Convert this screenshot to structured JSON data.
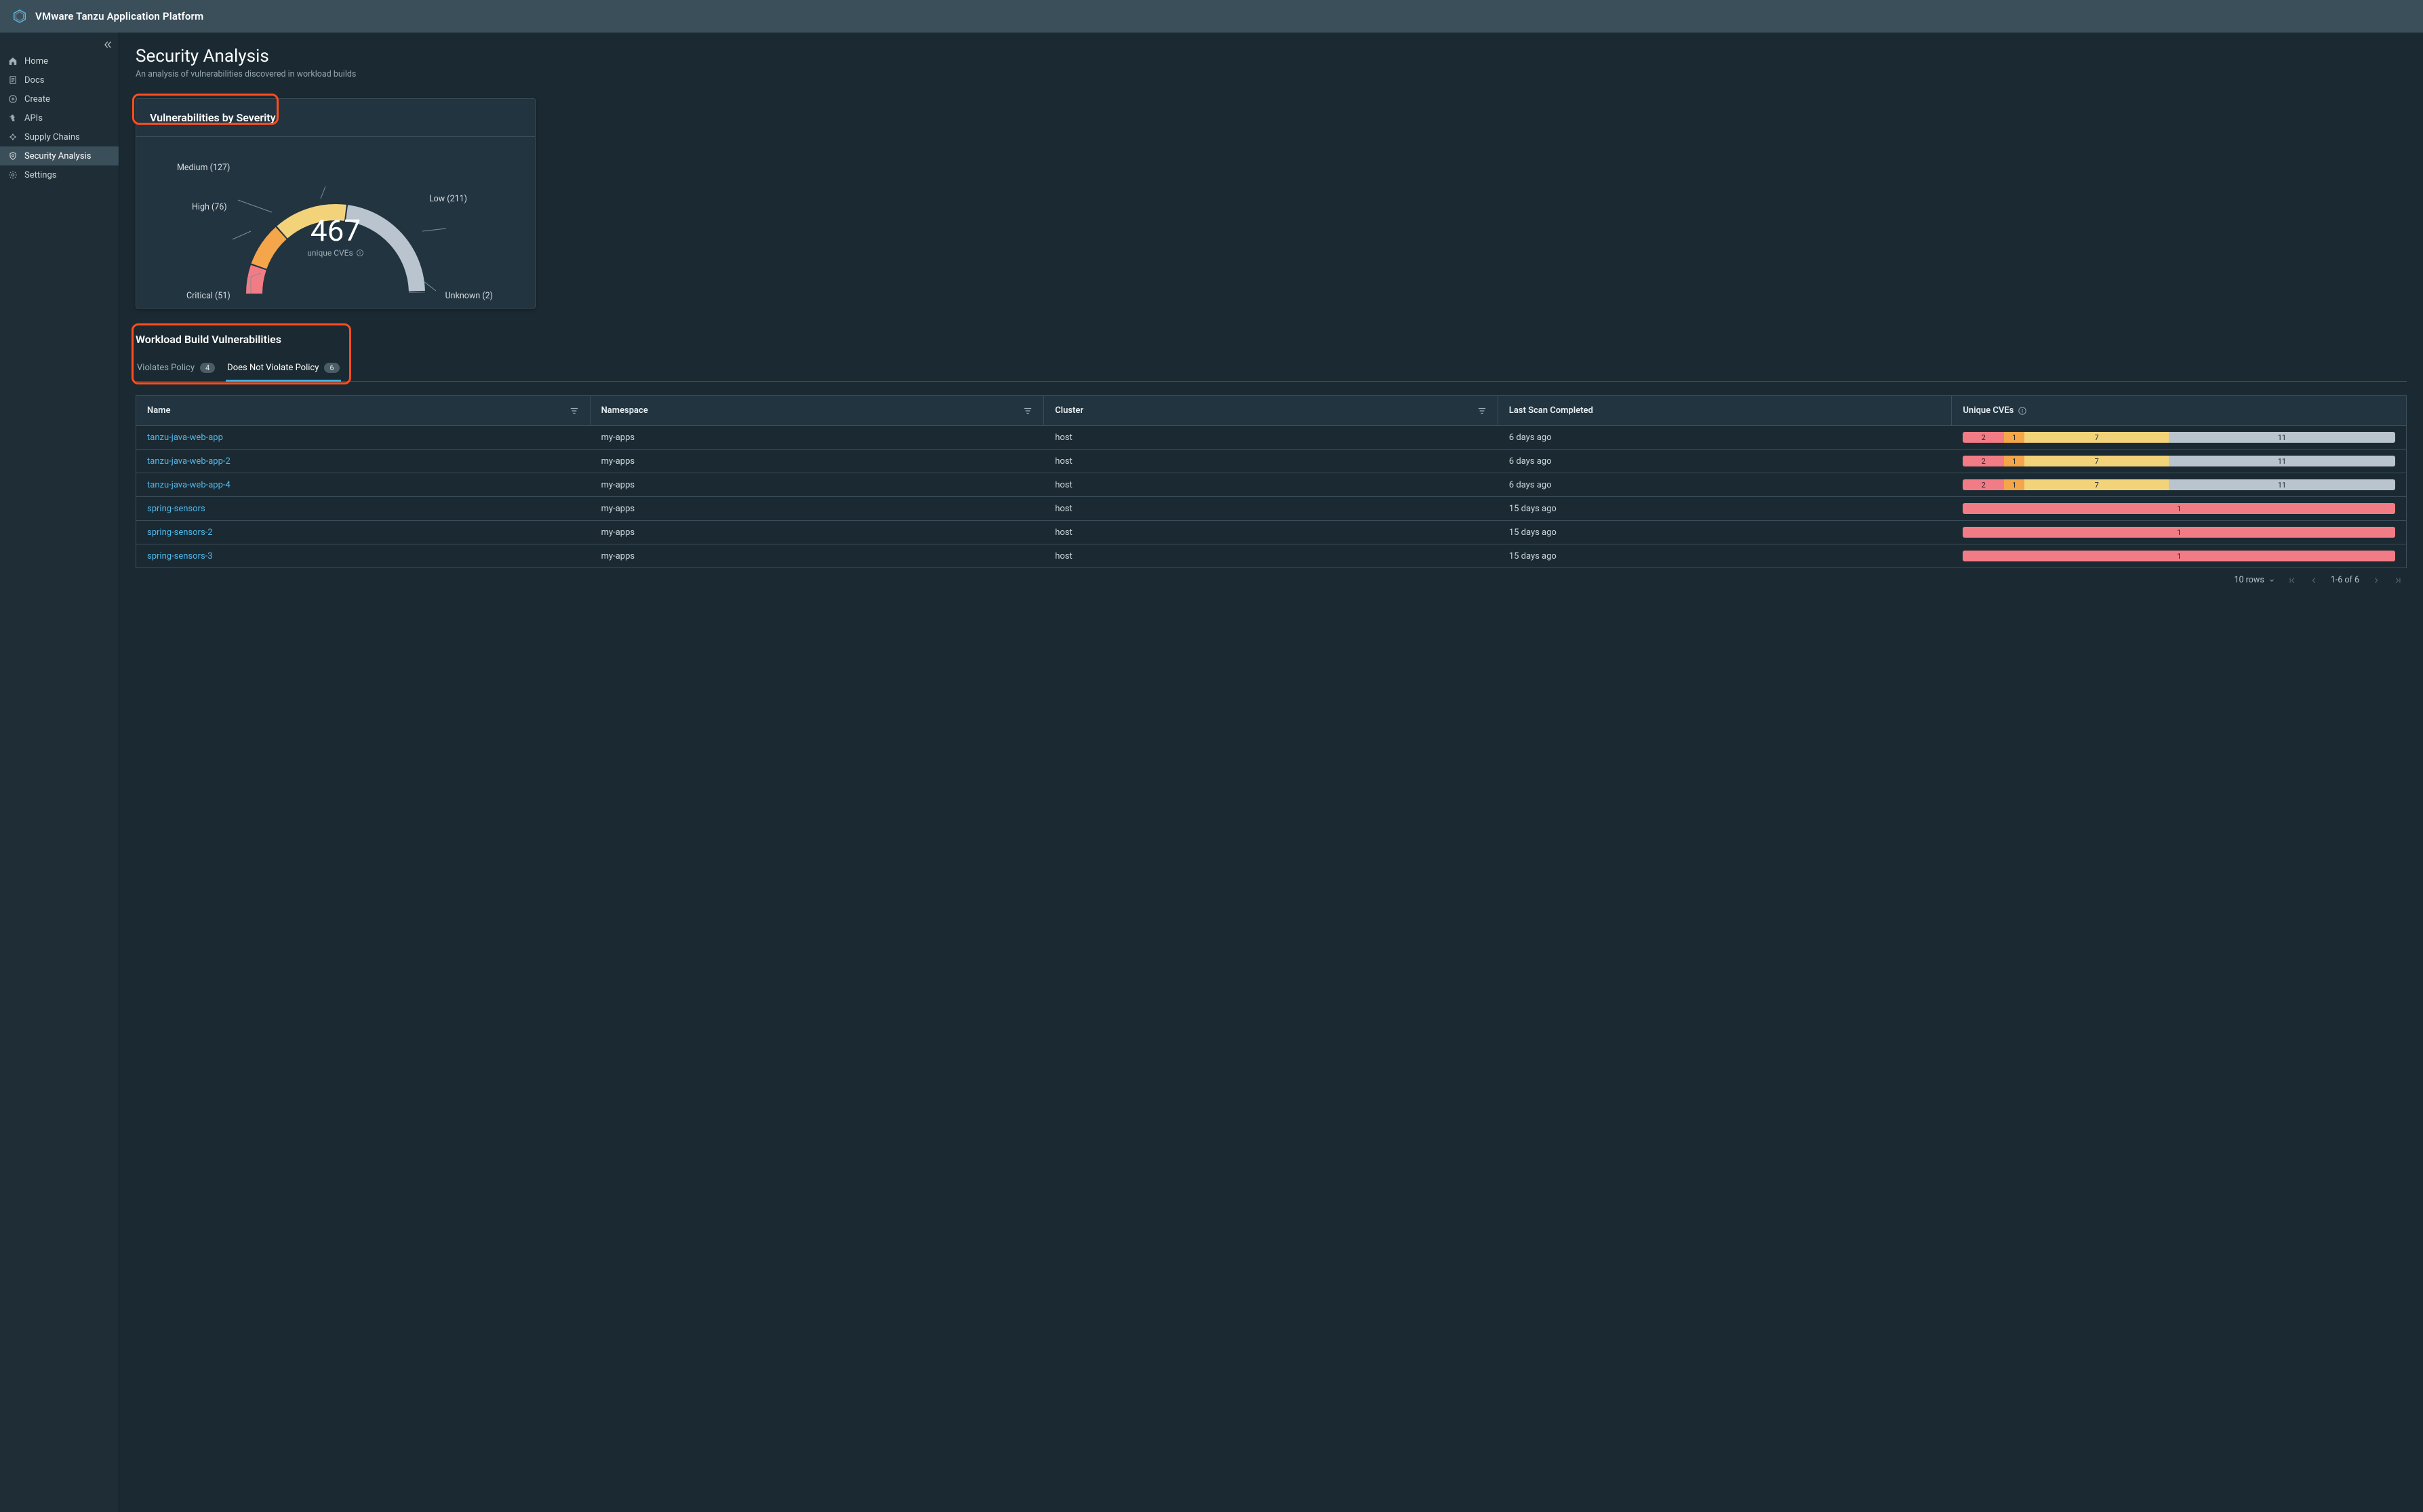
{
  "brand": "VMware Tanzu Application Platform",
  "sidebar": {
    "items": [
      {
        "label": "Home",
        "icon": "home"
      },
      {
        "label": "Docs",
        "icon": "docs"
      },
      {
        "label": "Create",
        "icon": "create"
      },
      {
        "label": "APIs",
        "icon": "puzzle"
      },
      {
        "label": "Supply Chains",
        "icon": "chains"
      },
      {
        "label": "Security Analysis",
        "icon": "shield"
      },
      {
        "label": "Settings",
        "icon": "gear"
      }
    ],
    "active_index": 5
  },
  "page": {
    "title": "Security Analysis",
    "subtitle": "An analysis of vulnerabilities discovered in workload builds"
  },
  "severity_card": {
    "title": "Vulnerabilities by Severity",
    "total": "467",
    "total_caption": "unique CVEs",
    "labels": {
      "critical": "Critical (51)",
      "high": "High (76)",
      "medium": "Medium (127)",
      "low": "Low (211)",
      "unknown": "Unknown (2)"
    }
  },
  "chart_data": {
    "type": "pie",
    "title": "Vulnerabilities by Severity",
    "total_label": "unique CVEs",
    "total": 467,
    "categories": [
      "Critical",
      "High",
      "Medium",
      "Low",
      "Unknown"
    ],
    "values": [
      51,
      76,
      127,
      211,
      2
    ],
    "colors": [
      "#f27c85",
      "#f5a54a",
      "#f3d37a",
      "#b9c4ce",
      "#8a97a4"
    ]
  },
  "workloads": {
    "title": "Workload Build Vulnerabilities",
    "tabs": [
      {
        "label": "Violates Policy",
        "count": "4"
      },
      {
        "label": "Does Not Violate Policy",
        "count": "6"
      }
    ],
    "active_tab": 1,
    "columns": [
      "Name",
      "Namespace",
      "Cluster",
      "Last Scan Completed",
      "Unique CVEs"
    ],
    "rows": [
      {
        "name": "tanzu-java-web-app",
        "ns": "my-apps",
        "cluster": "host",
        "scan": "6 days ago",
        "cve": {
          "crit": 2,
          "high": 1,
          "med": 7,
          "low": 11
        }
      },
      {
        "name": "tanzu-java-web-app-2",
        "ns": "my-apps",
        "cluster": "host",
        "scan": "6 days ago",
        "cve": {
          "crit": 2,
          "high": 1,
          "med": 7,
          "low": 11
        }
      },
      {
        "name": "tanzu-java-web-app-4",
        "ns": "my-apps",
        "cluster": "host",
        "scan": "6 days ago",
        "cve": {
          "crit": 2,
          "high": 1,
          "med": 7,
          "low": 11
        }
      },
      {
        "name": "spring-sensors",
        "ns": "my-apps",
        "cluster": "host",
        "scan": "15 days ago",
        "cve": {
          "crit": 1
        }
      },
      {
        "name": "spring-sensors-2",
        "ns": "my-apps",
        "cluster": "host",
        "scan": "15 days ago",
        "cve": {
          "crit": 1
        }
      },
      {
        "name": "spring-sensors-3",
        "ns": "my-apps",
        "cluster": "host",
        "scan": "15 days ago",
        "cve": {
          "crit": 1
        }
      }
    ]
  },
  "pager": {
    "rows_label": "10 rows",
    "range": "1-6 of 6"
  }
}
